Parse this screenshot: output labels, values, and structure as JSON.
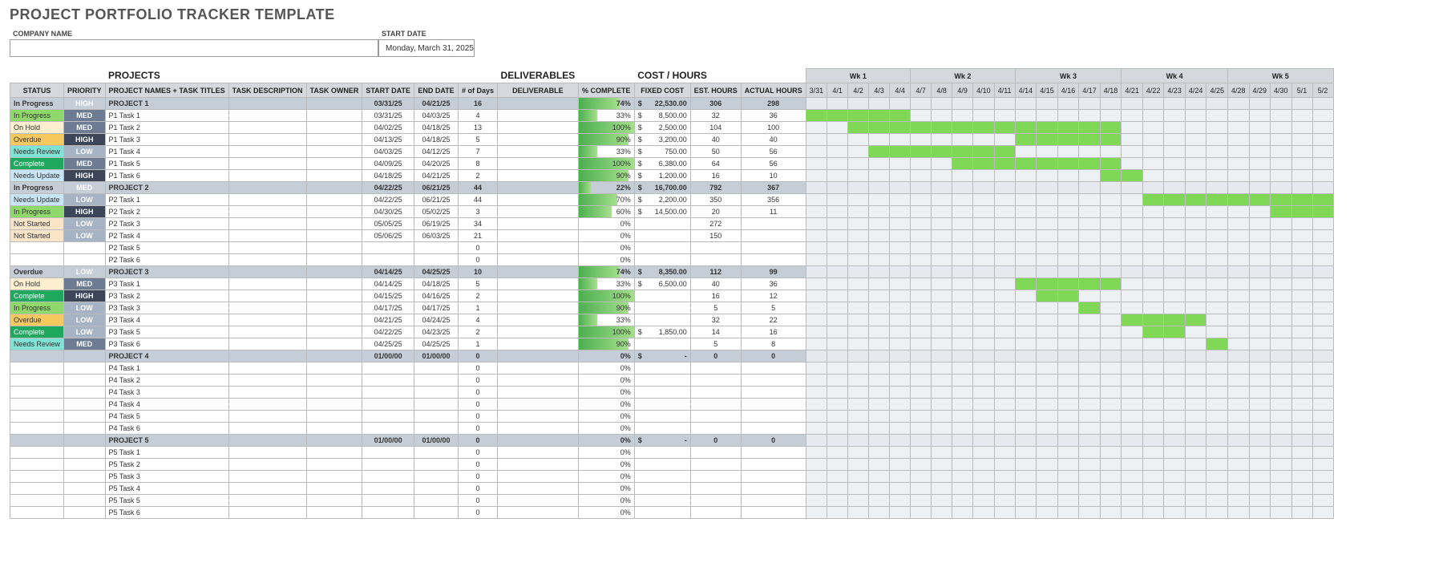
{
  "title": "PROJECT PORTFOLIO TRACKER TEMPLATE",
  "header": {
    "company_label": "COMPANY NAME",
    "company_value": "",
    "start_date_label": "START DATE",
    "start_date_value": "Monday, March 31, 2025"
  },
  "sections": {
    "projects": "PROJECTS",
    "deliverables": "DELIVERABLES",
    "cost_hours": "COST / HOURS"
  },
  "columns": {
    "status": "STATUS",
    "priority": "PRIORITY",
    "name": "PROJECT NAMES + TASK TITLES",
    "desc": "TASK DESCRIPTION",
    "owner": "TASK OWNER",
    "start": "START DATE",
    "end": "END DATE",
    "days": "# of Days",
    "deliverable": "DELIVERABLE",
    "pct": "% COMPLETE",
    "cost": "FIXED COST",
    "est": "EST. HOURS",
    "act": "ACTUAL HOURS"
  },
  "weeks": [
    "Wk 1",
    "Wk 2",
    "Wk 3",
    "Wk 4",
    "Wk 5"
  ],
  "dates": [
    "3/31",
    "4/1",
    "4/2",
    "4/3",
    "4/4",
    "4/7",
    "4/8",
    "4/9",
    "4/10",
    "4/11",
    "4/14",
    "4/15",
    "4/16",
    "4/17",
    "4/18",
    "4/21",
    "4/22",
    "4/23",
    "4/24",
    "4/25",
    "4/28",
    "4/29",
    "4/30",
    "5/1",
    "5/2"
  ],
  "rows": [
    {
      "type": "project",
      "status": "In Progress",
      "st": "inprogress",
      "priority": "HIGH",
      "pr": "high",
      "name": "PROJECT 1",
      "start": "03/31/25",
      "end": "04/21/25",
      "days": "16",
      "pct": "74%",
      "pctv": 74,
      "cost": "22,530.00",
      "est": "306",
      "act": "298",
      "g": [
        0,
        15,
        "proj"
      ]
    },
    {
      "type": "task",
      "status": "In Progress",
      "st": "inprogress",
      "priority": "MED",
      "pr": "med",
      "name": "P1 Task 1",
      "start": "03/31/25",
      "end": "04/03/25",
      "days": "4",
      "pct": "33%",
      "pctv": 33,
      "cost": "8,500.00",
      "est": "32",
      "act": "36",
      "g": [
        0,
        4,
        "task"
      ]
    },
    {
      "type": "task",
      "status": "On Hold",
      "st": "onhold",
      "priority": "MED",
      "pr": "med",
      "name": "P1 Task 2",
      "start": "04/02/25",
      "end": "04/18/25",
      "days": "13",
      "pct": "100%",
      "pctv": 100,
      "cost": "2,500.00",
      "est": "104",
      "act": "100",
      "g": [
        2,
        14,
        "task"
      ]
    },
    {
      "type": "task",
      "status": "Overdue",
      "st": "overdue",
      "priority": "HIGH",
      "pr": "high",
      "name": "P1 Task 3",
      "start": "04/13/25",
      "end": "04/18/25",
      "days": "5",
      "pct": "90%",
      "pctv": 90,
      "cost": "3,200.00",
      "est": "40",
      "act": "40",
      "g": [
        10,
        14,
        "task"
      ]
    },
    {
      "type": "task",
      "status": "Needs Review",
      "st": "needsreview",
      "priority": "LOW",
      "pr": "low",
      "name": "P1 Task 4",
      "start": "04/03/25",
      "end": "04/12/25",
      "days": "7",
      "pct": "33%",
      "pctv": 33,
      "cost": "750.00",
      "est": "50",
      "act": "56",
      "g": [
        3,
        9,
        "task"
      ]
    },
    {
      "type": "task",
      "status": "Complete",
      "st": "complete",
      "priority": "MED",
      "pr": "med",
      "name": "P1 Task 5",
      "start": "04/09/25",
      "end": "04/20/25",
      "days": "8",
      "pct": "100%",
      "pctv": 100,
      "cost": "6,380.00",
      "est": "64",
      "act": "56",
      "g": [
        7,
        14,
        "task"
      ]
    },
    {
      "type": "task",
      "status": "Needs Update",
      "st": "needsupdate",
      "priority": "HIGH",
      "pr": "high",
      "name": "P1 Task 6",
      "start": "04/18/25",
      "end": "04/21/25",
      "days": "2",
      "pct": "90%",
      "pctv": 90,
      "cost": "1,200.00",
      "est": "16",
      "act": "10",
      "g": [
        14,
        15,
        "task"
      ]
    },
    {
      "type": "project",
      "status": "In Progress",
      "st": "inprogress",
      "priority": "MED",
      "pr": "med",
      "name": "PROJECT 2",
      "start": "04/22/25",
      "end": "06/21/25",
      "days": "44",
      "pct": "22%",
      "pctv": 22,
      "cost": "16,700.00",
      "est": "792",
      "act": "367",
      "g": [
        16,
        24,
        "proj"
      ]
    },
    {
      "type": "task",
      "status": "Needs Update",
      "st": "needsupdate",
      "priority": "LOW",
      "pr": "low",
      "name": "P2 Task 1",
      "start": "04/22/25",
      "end": "06/21/25",
      "days": "44",
      "pct": "70%",
      "pctv": 70,
      "cost": "2,200.00",
      "est": "350",
      "act": "356",
      "g": [
        16,
        24,
        "task"
      ]
    },
    {
      "type": "task",
      "status": "In Progress",
      "st": "inprogress",
      "priority": "HIGH",
      "pr": "high",
      "name": "P2 Task 2",
      "start": "04/30/25",
      "end": "05/02/25",
      "days": "3",
      "pct": "60%",
      "pctv": 60,
      "cost": "14,500.00",
      "est": "20",
      "act": "11",
      "g": [
        22,
        24,
        "task"
      ]
    },
    {
      "type": "task",
      "status": "Not Started",
      "st": "notstarted",
      "priority": "LOW",
      "pr": "low",
      "name": "P2 Task 3",
      "start": "05/05/25",
      "end": "06/19/25",
      "days": "34",
      "pct": "0%",
      "pctv": 0,
      "cost": "",
      "est": "272",
      "act": "",
      "g": null
    },
    {
      "type": "task",
      "status": "Not Started",
      "st": "notstarted",
      "priority": "LOW",
      "pr": "low",
      "name": "P2 Task 4",
      "start": "05/06/25",
      "end": "06/03/25",
      "days": "21",
      "pct": "0%",
      "pctv": 0,
      "cost": "",
      "est": "150",
      "act": "",
      "g": null
    },
    {
      "type": "task",
      "status": "",
      "st": "blank",
      "priority": "",
      "pr": "blank",
      "name": "P2 Task 5",
      "start": "",
      "end": "",
      "days": "0",
      "pct": "0%",
      "pctv": 0,
      "cost": "",
      "est": "",
      "act": "",
      "g": null
    },
    {
      "type": "task",
      "status": "",
      "st": "blank",
      "priority": "",
      "pr": "blank",
      "name": "P2 Task 6",
      "start": "",
      "end": "",
      "days": "0",
      "pct": "0%",
      "pctv": 0,
      "cost": "",
      "est": "",
      "act": "",
      "g": null
    },
    {
      "type": "project",
      "status": "Overdue",
      "st": "overdue",
      "priority": "LOW",
      "pr": "low",
      "name": "PROJECT 3",
      "start": "04/14/25",
      "end": "04/25/25",
      "days": "10",
      "pct": "74%",
      "pctv": 74,
      "cost": "8,350.00",
      "est": "112",
      "act": "99",
      "g": [
        10,
        19,
        "proj"
      ]
    },
    {
      "type": "task",
      "status": "On Hold",
      "st": "onhold",
      "priority": "MED",
      "pr": "med",
      "name": "P3 Task 1",
      "start": "04/14/25",
      "end": "04/18/25",
      "days": "5",
      "pct": "33%",
      "pctv": 33,
      "cost": "6,500.00",
      "est": "40",
      "act": "36",
      "g": [
        10,
        14,
        "task"
      ]
    },
    {
      "type": "task",
      "status": "Complete",
      "st": "complete",
      "priority": "HIGH",
      "pr": "high",
      "name": "P3 Task 2",
      "start": "04/15/25",
      "end": "04/16/25",
      "days": "2",
      "pct": "100%",
      "pctv": 100,
      "cost": "",
      "est": "16",
      "act": "12",
      "g": [
        11,
        12,
        "task"
      ]
    },
    {
      "type": "task",
      "status": "In Progress",
      "st": "inprogress",
      "priority": "LOW",
      "pr": "low",
      "name": "P3 Task 3",
      "start": "04/17/25",
      "end": "04/17/25",
      "days": "1",
      "pct": "90%",
      "pctv": 90,
      "cost": "",
      "est": "5",
      "act": "5",
      "g": [
        13,
        13,
        "task"
      ]
    },
    {
      "type": "task",
      "status": "Overdue",
      "st": "overdue",
      "priority": "LOW",
      "pr": "low",
      "name": "P3 Task 4",
      "start": "04/21/25",
      "end": "04/24/25",
      "days": "4",
      "pct": "33%",
      "pctv": 33,
      "cost": "",
      "est": "32",
      "act": "22",
      "g": [
        15,
        18,
        "task"
      ]
    },
    {
      "type": "task",
      "status": "Complete",
      "st": "complete",
      "priority": "LOW",
      "pr": "low",
      "name": "P3 Task 5",
      "start": "04/22/25",
      "end": "04/23/25",
      "days": "2",
      "pct": "100%",
      "pctv": 100,
      "cost": "1,850.00",
      "est": "14",
      "act": "16",
      "g": [
        16,
        17,
        "task"
      ]
    },
    {
      "type": "task",
      "status": "Needs Review",
      "st": "needsreview",
      "priority": "MED",
      "pr": "med",
      "name": "P3 Task 6",
      "start": "04/25/25",
      "end": "04/25/25",
      "days": "1",
      "pct": "90%",
      "pctv": 90,
      "cost": "",
      "est": "5",
      "act": "8",
      "g": [
        19,
        19,
        "task"
      ]
    },
    {
      "type": "project",
      "status": "",
      "st": "blank",
      "priority": "",
      "pr": "blank",
      "name": "PROJECT 4",
      "start": "01/00/00",
      "end": "01/00/00",
      "days": "0",
      "pct": "0%",
      "pctv": 0,
      "cost": "-",
      "est": "0",
      "act": "0",
      "g": null,
      "showDollar": true
    },
    {
      "type": "task",
      "status": "",
      "st": "blank",
      "priority": "",
      "pr": "blank",
      "name": "P4 Task 1",
      "start": "",
      "end": "",
      "days": "0",
      "pct": "0%",
      "pctv": 0,
      "cost": "",
      "est": "",
      "act": "",
      "g": null
    },
    {
      "type": "task",
      "status": "",
      "st": "blank",
      "priority": "",
      "pr": "blank",
      "name": "P4 Task 2",
      "start": "",
      "end": "",
      "days": "0",
      "pct": "0%",
      "pctv": 0,
      "cost": "",
      "est": "",
      "act": "",
      "g": null
    },
    {
      "type": "task",
      "status": "",
      "st": "blank",
      "priority": "",
      "pr": "blank",
      "name": "P4 Task 3",
      "start": "",
      "end": "",
      "days": "0",
      "pct": "0%",
      "pctv": 0,
      "cost": "",
      "est": "",
      "act": "",
      "g": null
    },
    {
      "type": "task",
      "status": "",
      "st": "blank",
      "priority": "",
      "pr": "blank",
      "name": "P4 Task 4",
      "start": "",
      "end": "",
      "days": "0",
      "pct": "0%",
      "pctv": 0,
      "cost": "",
      "est": "",
      "act": "",
      "g": null
    },
    {
      "type": "task",
      "status": "",
      "st": "blank",
      "priority": "",
      "pr": "blank",
      "name": "P4 Task 5",
      "start": "",
      "end": "",
      "days": "0",
      "pct": "0%",
      "pctv": 0,
      "cost": "",
      "est": "",
      "act": "",
      "g": null
    },
    {
      "type": "task",
      "status": "",
      "st": "blank",
      "priority": "",
      "pr": "blank",
      "name": "P4 Task 6",
      "start": "",
      "end": "",
      "days": "0",
      "pct": "0%",
      "pctv": 0,
      "cost": "",
      "est": "",
      "act": "",
      "g": null
    },
    {
      "type": "project",
      "status": "",
      "st": "blank",
      "priority": "",
      "pr": "blank",
      "name": "PROJECT 5",
      "start": "01/00/00",
      "end": "01/00/00",
      "days": "0",
      "pct": "0%",
      "pctv": 0,
      "cost": "-",
      "est": "0",
      "act": "0",
      "g": null,
      "showDollar": true
    },
    {
      "type": "task",
      "status": "",
      "st": "blank",
      "priority": "",
      "pr": "blank",
      "name": "P5 Task 1",
      "start": "",
      "end": "",
      "days": "0",
      "pct": "0%",
      "pctv": 0,
      "cost": "",
      "est": "",
      "act": "",
      "g": null
    },
    {
      "type": "task",
      "status": "",
      "st": "blank",
      "priority": "",
      "pr": "blank",
      "name": "P5 Task 2",
      "start": "",
      "end": "",
      "days": "0",
      "pct": "0%",
      "pctv": 0,
      "cost": "",
      "est": "",
      "act": "",
      "g": null
    },
    {
      "type": "task",
      "status": "",
      "st": "blank",
      "priority": "",
      "pr": "blank",
      "name": "P5 Task 3",
      "start": "",
      "end": "",
      "days": "0",
      "pct": "0%",
      "pctv": 0,
      "cost": "",
      "est": "",
      "act": "",
      "g": null
    },
    {
      "type": "task",
      "status": "",
      "st": "blank",
      "priority": "",
      "pr": "blank",
      "name": "P5 Task 4",
      "start": "",
      "end": "",
      "days": "0",
      "pct": "0%",
      "pctv": 0,
      "cost": "",
      "est": "",
      "act": "",
      "g": null
    },
    {
      "type": "task",
      "status": "",
      "st": "blank",
      "priority": "",
      "pr": "blank",
      "name": "P5 Task 5",
      "start": "",
      "end": "",
      "days": "0",
      "pct": "0%",
      "pctv": 0,
      "cost": "",
      "est": "",
      "act": "",
      "g": null
    },
    {
      "type": "task",
      "status": "",
      "st": "blank",
      "priority": "",
      "pr": "blank",
      "name": "P5 Task 6",
      "start": "",
      "end": "",
      "days": "0",
      "pct": "0%",
      "pctv": 0,
      "cost": "",
      "est": "",
      "act": "",
      "g": null
    }
  ]
}
